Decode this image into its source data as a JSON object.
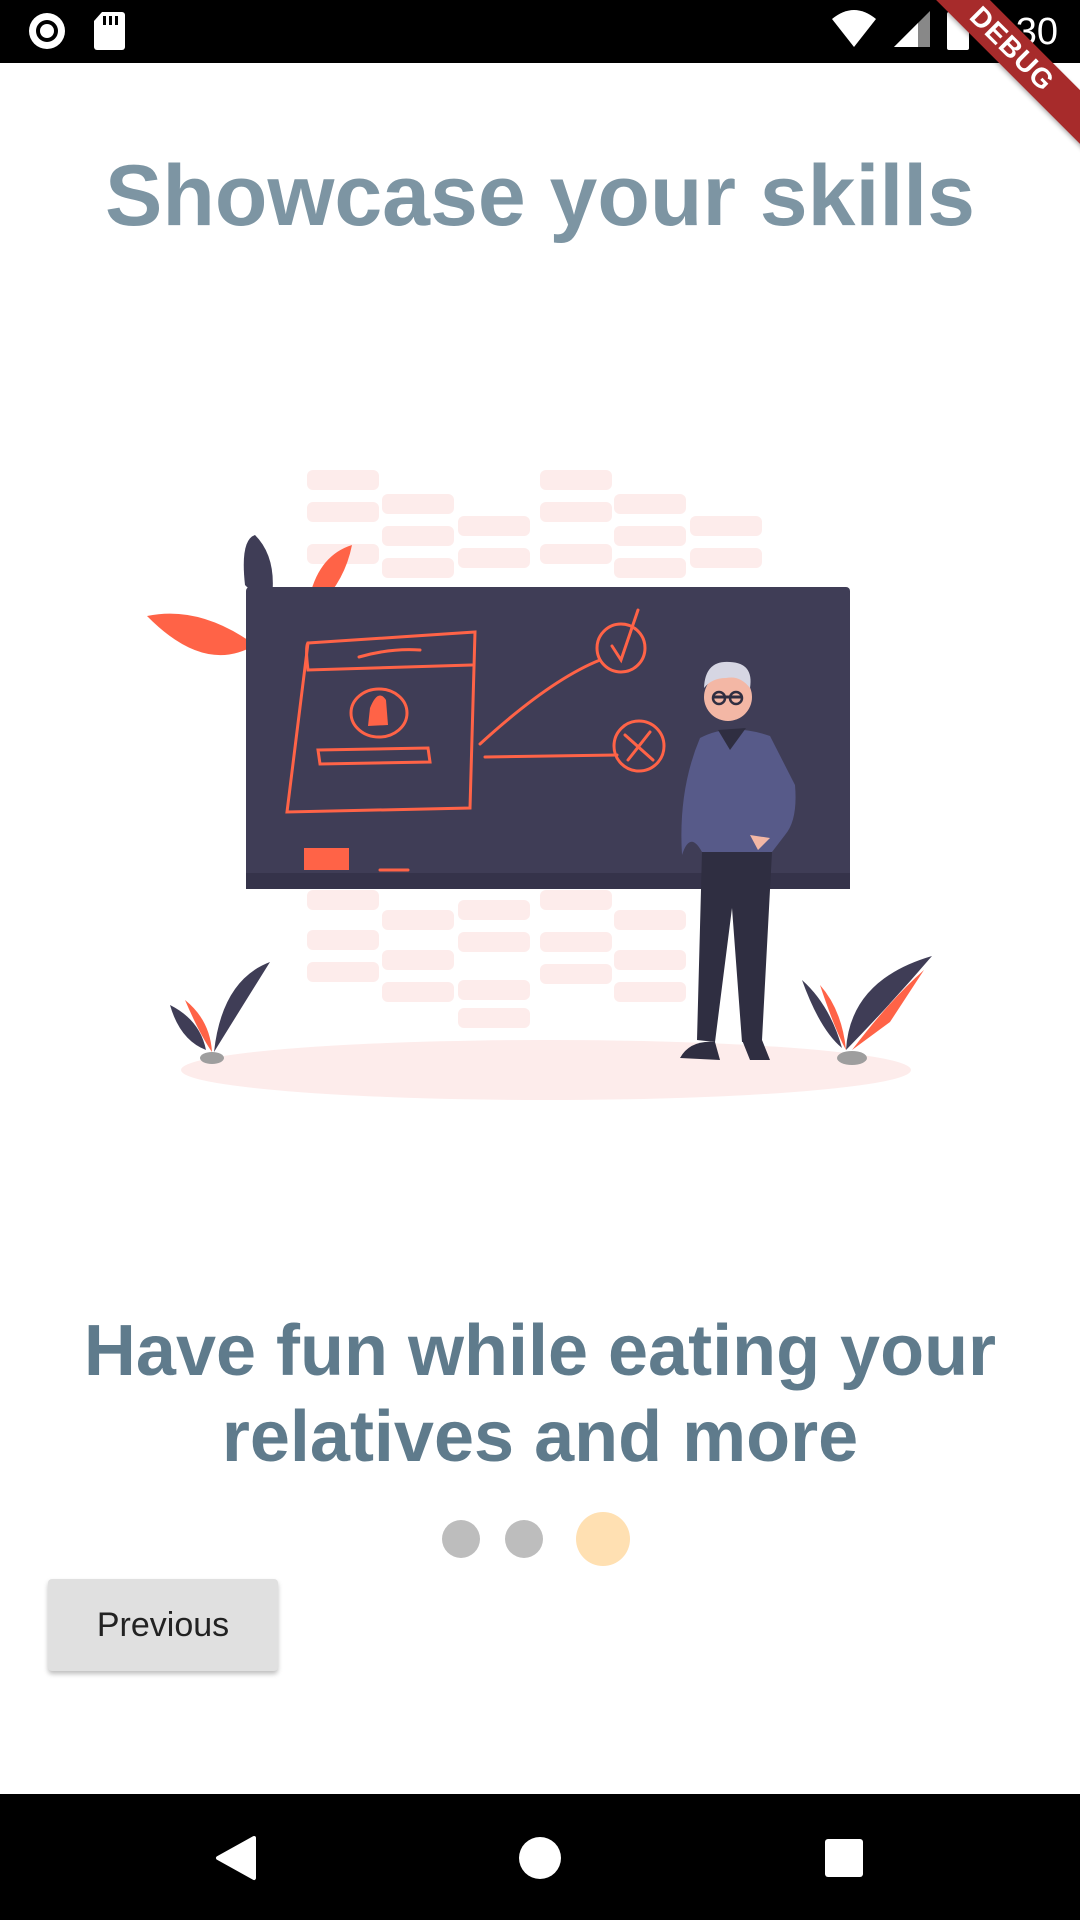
{
  "status_bar": {
    "time": "8:30",
    "icons": [
      "record-icon",
      "sd-card-icon",
      "wifi-icon",
      "signal-icon",
      "battery-icon"
    ]
  },
  "debug_banner": "DEBUG",
  "title": "Showcase your skills",
  "headline": "Have fun while eating your relatives and more",
  "page_indicator": {
    "total": 3,
    "active": 3,
    "active_color": "#ffe0b2",
    "inactive_color": "#bdbdbd"
  },
  "previous_button": {
    "label": "Previous"
  },
  "nav_bar": {
    "icons": [
      "back-icon",
      "home-icon",
      "recents-icon"
    ]
  },
  "colors": {
    "title": "#7d95a3",
    "headline": "#5f7b8c",
    "accent": "#ff6347",
    "board": "#3f3d56"
  }
}
